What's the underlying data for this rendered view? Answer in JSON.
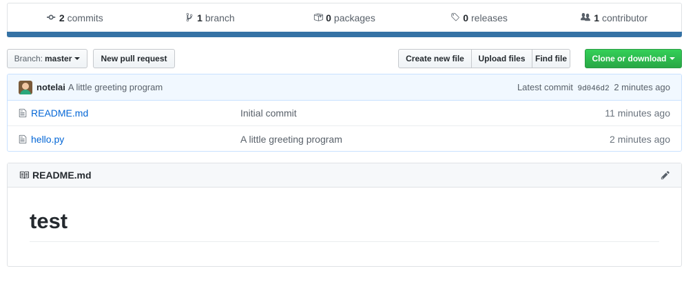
{
  "summary": {
    "commits": {
      "count": "2",
      "label": "commits",
      "icon": "history-icon"
    },
    "branches": {
      "count": "1",
      "label": "branch",
      "icon": "git-branch-icon"
    },
    "packages": {
      "count": "0",
      "label": "packages",
      "icon": "package-icon"
    },
    "releases": {
      "count": "0",
      "label": "releases",
      "icon": "tag-icon"
    },
    "contributors": {
      "count": "1",
      "label": "contributor",
      "icon": "people-icon"
    },
    "language_color": "#3572A5"
  },
  "toolbar": {
    "branch_prefix": "Branch:",
    "branch_value": "master",
    "new_pr_label": "New pull request",
    "create_file_label": "Create new file",
    "upload_files_label": "Upload files",
    "find_file_label": "Find file",
    "clone_label": "Clone or download",
    "clone_color": "#28a745"
  },
  "latest_commit": {
    "author": "notelai",
    "message": "A little greeting program",
    "prefix": "Latest commit",
    "sha": "9d046d2",
    "age": "2 minutes ago"
  },
  "files": [
    {
      "name": "README.md",
      "message": "Initial commit",
      "age": "11 minutes ago",
      "icon": "file-icon"
    },
    {
      "name": "hello.py",
      "message": "A little greeting program",
      "age": "2 minutes ago",
      "icon": "file-icon"
    }
  ],
  "readme": {
    "title": "README.md",
    "heading": "test",
    "icon": "book-icon"
  }
}
